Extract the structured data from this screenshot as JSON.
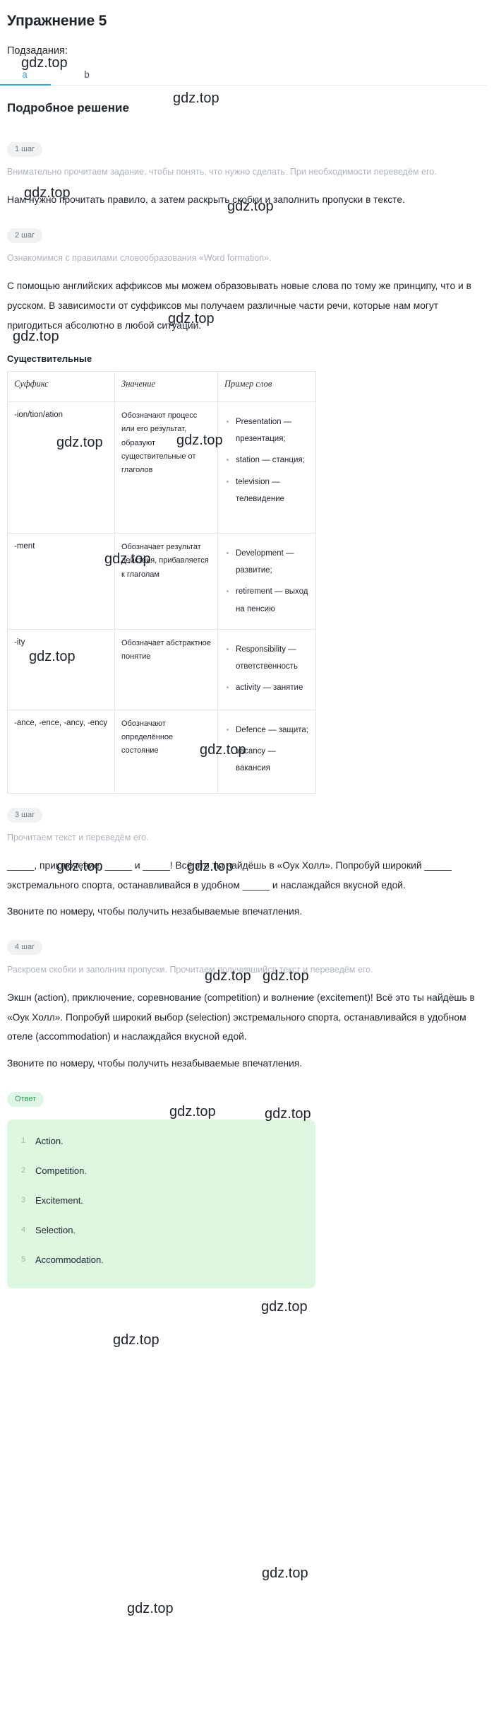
{
  "header": {
    "exercise_title": "Упражнение 5",
    "subtasks_label": "Подзадания:",
    "tabs": [
      {
        "label": "a",
        "active": true
      },
      {
        "label": "b",
        "active": false
      }
    ],
    "section_title": "Подробное решение"
  },
  "steps": [
    {
      "chip": "1 шаг",
      "muted": "Внимательно прочитаем задание, чтобы понять, что нужно сделать. При необходимости переведём его.",
      "body": [
        "Нам нужно прочитать правило, а затем раскрыть скобки и заполнить пропуски в тексте."
      ]
    },
    {
      "chip": "2 шаг",
      "muted": "Ознакомимся с правилами словообразования «Word formation».",
      "body": [
        "С помощью английских аффиксов мы можем образовывать новые слова по тому же принципу, что и в русском. В зависимости от суффиксов мы получаем различные части речи, которые нам могут пригодиться абсолютно в любой ситуации."
      ]
    },
    {
      "chip": "3 шаг",
      "muted": "Прочитаем текст и переведём его.",
      "body": [
        "_____, приключение, _____ и _____! Всё это ты найдёшь в «Оук Холл». Попробуй широкий _____ экстремального спорта, останавливайся в удобном _____ и наслаждайся вкусной едой.",
        "Звоните по номеру, чтобы получить незабываемые впечатления."
      ]
    },
    {
      "chip": "4 шаг",
      "muted": "Раскроем скобки и заполним пропуски. Прочитаем получившийся текст и переведём его.",
      "body": [
        "Экшн (action), приключение, соревнование (competition) и волнение (excitement)! Всё это ты найдёшь в «Оук Холл». Попробуй широкий выбор (selection) экстремального спорта, останавливайся в удобном отеле (accommodation) и наслаждайся вкусной едой.",
        "Звоните по номеру, чтобы получить незабываемые впечатления."
      ]
    }
  ],
  "nouns_heading": "Существительные",
  "table": {
    "headers": [
      "Суффикс",
      "Значение",
      "Пример слов"
    ],
    "rows": [
      {
        "suffix": "-ion/tion/ation",
        "meaning": "Обозначают процесс или его результат, образуют существительные от глаголов",
        "examples": [
          "Presentation — презентация;",
          "station — станция;",
          "television — телевидение"
        ]
      },
      {
        "suffix": "-ment",
        "meaning": "Обозначает результат действия, прибавляется к глаголам",
        "examples": [
          "Development — развитие;",
          "retirement — выход на пенсию"
        ]
      },
      {
        "suffix": "-ity",
        "meaning": "Обозначает абстрактное понятие",
        "examples": [
          "Responsibility — ответственность",
          "activity — занятие"
        ]
      },
      {
        "suffix": "-ance, -ence, -ancy, -ency",
        "meaning": "Обозначают определённое состояние",
        "examples": [
          "Defence — защита;",
          "vacancy — вакансия"
        ]
      }
    ]
  },
  "answer": {
    "chip": "Ответ",
    "items": [
      "Action.",
      "Competition.",
      "Excitement.",
      "Selection.",
      "Accommodation."
    ]
  },
  "watermarks": {
    "text": "gdz.top"
  },
  "colors": {
    "accent": "#2aa7dc",
    "answer_bg": "#ddf7e1",
    "answer_chip_text": "#2f9e5c",
    "muted_text": "#aeb4bd"
  }
}
